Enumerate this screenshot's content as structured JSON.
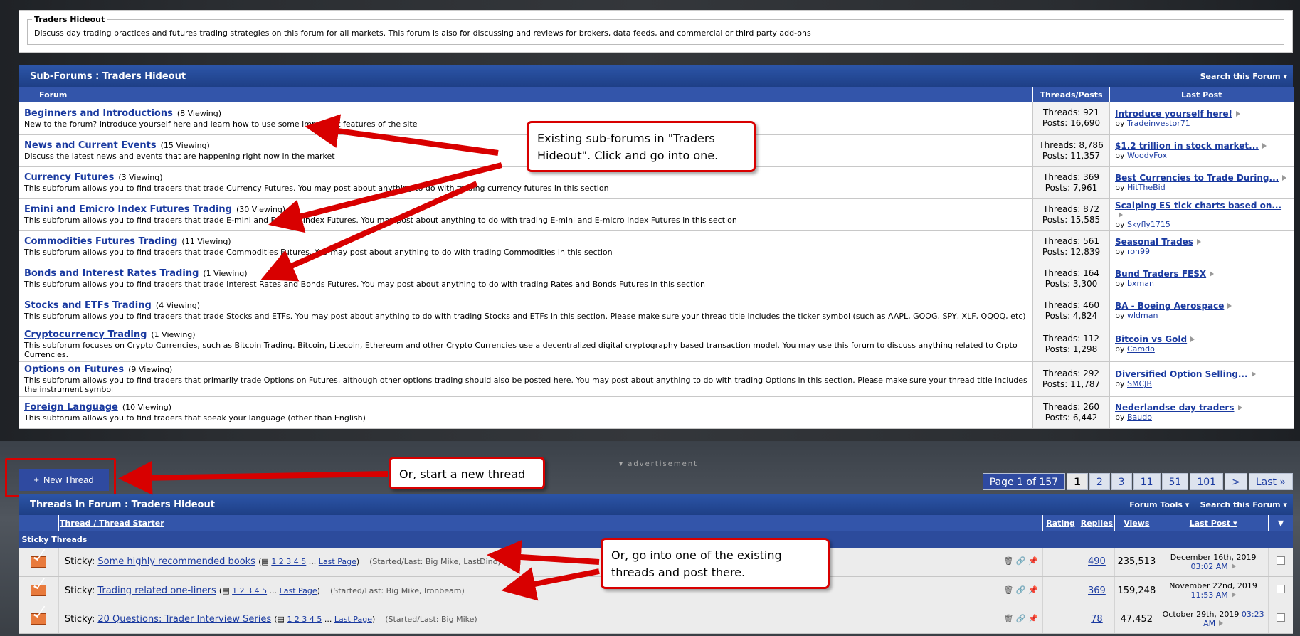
{
  "forum_desc": {
    "title": "Traders Hideout",
    "text": "Discuss day trading practices and futures trading strategies on this forum for all markets. This forum is also for discussing and reviews for brokers, data feeds, and commercial or third party add-ons"
  },
  "subforums": {
    "title": "Sub-Forums : Traders Hideout",
    "search": "Search this Forum",
    "columns": {
      "forum": "Forum",
      "tp": "Threads/Posts",
      "lastpost": "Last Post"
    },
    "rows": [
      {
        "name": "Beginners and Introductions",
        "viewing": "(8 Viewing)",
        "desc": "New to the forum? Introduce yourself here and learn how to use some important features of the site",
        "threads": "Threads: 921",
        "posts": "Posts: 16,690",
        "lp": "Introduce yourself here!",
        "by": "by",
        "user": "Tradeinvestor71"
      },
      {
        "name": "News and Current Events",
        "viewing": "(15 Viewing)",
        "desc": "Discuss the latest news and events that are happening right now in the market",
        "threads": "Threads: 8,786",
        "posts": "Posts: 11,357",
        "lp": "$1.2 trillion in stock market...",
        "by": "by",
        "user": "WoodyFox"
      },
      {
        "name": "Currency Futures",
        "viewing": "(3 Viewing)",
        "desc": "This subforum allows you to find traders that trade Currency Futures. You may post about anything to do with trading currency futures in this section",
        "threads": "Threads: 369",
        "posts": "Posts: 7,961",
        "lp": "Best Currencies to Trade During...",
        "by": "by",
        "user": "HitTheBid"
      },
      {
        "name": "Emini and Emicro Index Futures Trading",
        "viewing": "(30 Viewing)",
        "desc": "This subforum allows you to find traders that trade E-mini and E-micro Index Futures. You may post about anything to do with trading E-mini and E-micro Index Futures in this section",
        "threads": "Threads: 872",
        "posts": "Posts: 15,585",
        "lp": "Scalping ES tick charts based on...",
        "by": "by",
        "user": "Skyfly1715"
      },
      {
        "name": "Commodities Futures Trading",
        "viewing": "(11 Viewing)",
        "desc": "This subforum allows you to find traders that trade Commodities Futures. You may post about anything to do with trading Commodities in this section",
        "threads": "Threads: 561",
        "posts": "Posts: 12,839",
        "lp": "Seasonal Trades",
        "by": "by",
        "user": "ron99"
      },
      {
        "name": "Bonds and Interest Rates Trading",
        "viewing": "(1 Viewing)",
        "desc": "This subforum allows you to find traders that trade Interest Rates and Bonds Futures. You may post about anything to do with trading Rates and Bonds Futures in this section",
        "threads": "Threads: 164",
        "posts": "Posts: 3,300",
        "lp": "Bund Traders FESX",
        "by": "by",
        "user": "bxman"
      },
      {
        "name": "Stocks and ETFs Trading",
        "viewing": "(4 Viewing)",
        "desc": "This subforum allows you to find traders that trade Stocks and ETFs. You may post about anything to do with trading Stocks and ETFs in this section. Please make sure your thread title includes the ticker symbol (such as AAPL, GOOG, SPY, XLF, QQQQ, etc)",
        "threads": "Threads: 460",
        "posts": "Posts: 4,824",
        "lp": "BA - Boeing Aerospace",
        "by": "by",
        "user": "wldman"
      },
      {
        "name": "Cryptocurrency Trading",
        "viewing": "(1 Viewing)",
        "desc": "This subforum focuses on Crypto Currencies, such as Bitcoin Trading. Bitcoin, Litecoin, Ethereum and other Crypto Currencies use a decentralized digital cryptography based transaction model. You may use this forum to discuss anything related to Crpto Currencies.",
        "threads": "Threads: 112",
        "posts": "Posts: 1,298",
        "lp": "Bitcoin vs Gold",
        "by": "by",
        "user": "Camdo"
      },
      {
        "name": "Options on Futures",
        "viewing": "(9 Viewing)",
        "desc": "This subforum allows you to find traders that primarily trade Options on Futures, although other options trading should also be posted here. You may post about anything to do with trading Options in this section. Please make sure your thread title includes the instrument symbol",
        "threads": "Threads: 292",
        "posts": "Posts: 11,787",
        "lp": "Diversified Option Selling...",
        "by": "by",
        "user": "SMCJB"
      },
      {
        "name": "Foreign Language",
        "viewing": "(10 Viewing)",
        "desc": "This subforum allows you to find traders that speak your language (other than English)",
        "threads": "Threads: 260",
        "posts": "Posts: 6,442",
        "lp": "Nederlandse day traders",
        "by": "by",
        "user": "Baudo"
      }
    ]
  },
  "new_thread": {
    "icon": "+",
    "label": "New Thread"
  },
  "advertisement": "advertisement",
  "pager": {
    "info": "Page 1 of 157",
    "pages": [
      "1",
      "2",
      "3",
      "11",
      "51",
      "101",
      ">",
      "Last »"
    ]
  },
  "threads": {
    "title": "Threads in Forum : Traders Hideout",
    "tools": "Forum Tools",
    "search": "Search this Forum",
    "col_thread": "Thread",
    "col_sep": "/",
    "col_starter": "Thread Starter",
    "col_rating": "Rating",
    "col_replies": "Replies",
    "col_views": "Views",
    "col_lastpost": "Last Post",
    "sticky_header": "Sticky Threads",
    "rows": [
      {
        "prefix": "Sticky:",
        "title": "Some highly recommended books",
        "pages": "1 2 3 4 5",
        "ell": "...",
        "last": "Last Page",
        "started": "(Started/Last: Big Mike, LastDino)",
        "replies": "490",
        "views": "235,513",
        "date": "December 16th, 2019",
        "time": "03:02 AM"
      },
      {
        "prefix": "Sticky:",
        "title": "Trading related one-liners",
        "pages": "1 2 3 4 5",
        "ell": "...",
        "last": "Last Page",
        "started": "(Started/Last: Big Mike, Ironbeam)",
        "replies": "369",
        "views": "159,248",
        "date": "November 22nd, 2019",
        "time": "11:53 AM"
      },
      {
        "prefix": "Sticky:",
        "title": "20 Questions: Trader Interview Series",
        "pages": "1 2 3 4 5",
        "ell": "...",
        "last": "Last Page",
        "started": "(Started/Last: Big Mike)",
        "replies": "78",
        "views": "47,452",
        "date": "October 29th, 2019",
        "time": "03:23 AM"
      }
    ]
  },
  "callouts": {
    "subforums": "Existing sub-forums in \"Traders Hideout\". Click and go into one.",
    "newthread": "Or, start a new thread",
    "threads": "Or, go into one of the existing threads and post there."
  },
  "colors": {
    "accent": "#2f4aa0",
    "annotation": "#d80000"
  }
}
